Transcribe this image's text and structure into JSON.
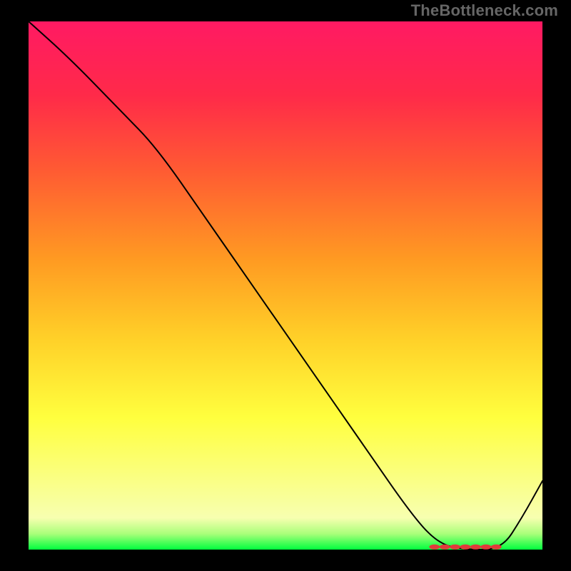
{
  "watermark": "TheBottleneck.com",
  "colors": {
    "background_black": "#000000",
    "marker": "#e03b3b",
    "line": "#000000",
    "gradient_top": "#ff1a63",
    "gradient_bottom": "#00ff3e"
  },
  "chart_data": {
    "type": "line",
    "title": "",
    "xlabel": "",
    "ylabel": "",
    "xlim": [
      0,
      100
    ],
    "ylim": [
      0,
      100
    ],
    "notes": [
      "No axis tick labels or numeric labels are rendered in the image.",
      "x roughly represents position along the horizontal axis (percent).",
      "y roughly represents the vertical position of the black curve; 0 = bottom (green), 100 = top (red/pink)."
    ],
    "series": [
      {
        "name": "curve",
        "x": [
          0,
          8,
          18,
          25,
          35,
          45,
          55,
          65,
          75,
          80,
          85,
          92,
          96,
          100
        ],
        "y": [
          100,
          93,
          83,
          76,
          62,
          48,
          34,
          20,
          6,
          1,
          0,
          0,
          6,
          13
        ]
      }
    ],
    "markers": {
      "description": "Cluster of small red ellipse markers along the valley floor near the right side.",
      "x": [
        79,
        81,
        83,
        85,
        87,
        89,
        91
      ],
      "y": [
        0.5,
        0.5,
        0.5,
        0.5,
        0.5,
        0.5,
        0.5
      ]
    }
  }
}
